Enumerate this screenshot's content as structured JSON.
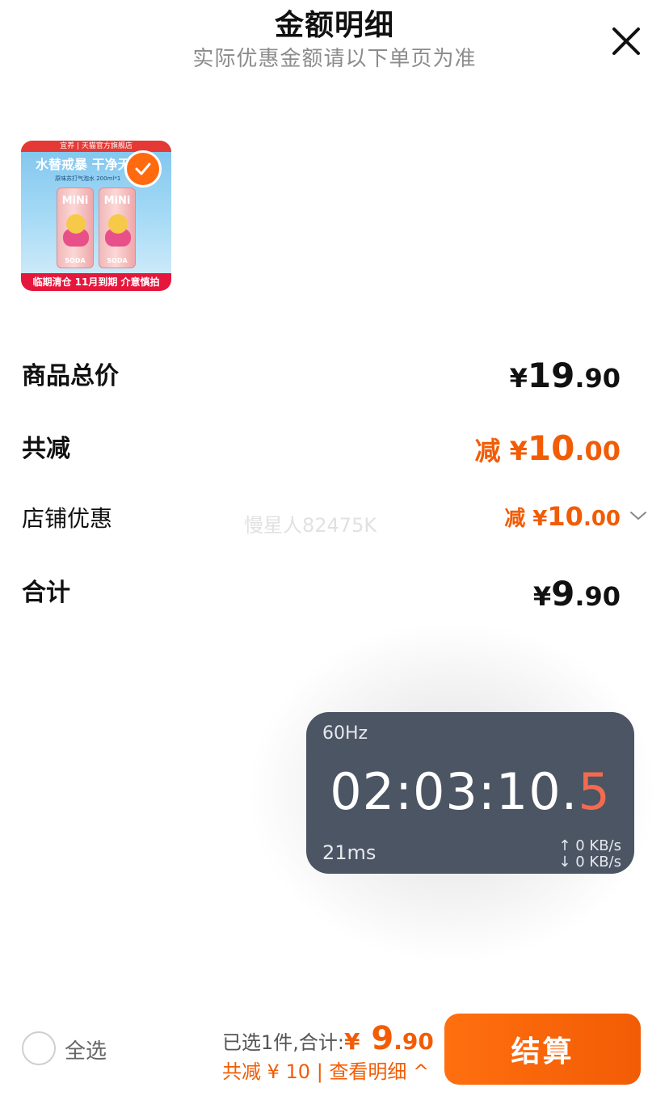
{
  "header": {
    "title": "金额明细",
    "subtitle": "实际优惠金额请以下单页为准"
  },
  "product": {
    "top_banner": "宜养 | 天猫官方旗舰店",
    "slogan": "水替戒暴 干净无",
    "desc": "原味苏打气泡水 200ml*1",
    "can_brand": "MiNi",
    "can_label": "SODA",
    "bottom_banner": "临期清仓 11月到期 介意慎拍",
    "checked": true
  },
  "rows": {
    "total_price": {
      "label": "商品总价",
      "currency": "¥",
      "integer": "19",
      "decimal": ".90"
    },
    "total_discount": {
      "label": "共减",
      "prefix": "减 ¥",
      "integer": "10",
      "decimal": ".00"
    },
    "store_discount": {
      "label": "店铺优惠",
      "prefix": "减 ¥",
      "integer": "10",
      "decimal": ".00"
    },
    "sum": {
      "label": "合计",
      "currency": "¥",
      "integer": "9",
      "decimal": ".90"
    }
  },
  "watermark": "慢星人82475K",
  "timer": {
    "refresh_rate": "60Hz",
    "time_main": "02:03:10.",
    "time_last": "5",
    "latency": "21ms",
    "upload": "↑ 0 KB/s",
    "download": "↓ 0 KB/s"
  },
  "bottom_bar": {
    "select_all": "全选",
    "selected_text": "已选1件,合计:",
    "currency": "¥",
    "integer": " 9",
    "decimal": ".90",
    "discount_text": "共减 ¥ 10 | 查看明细 ^",
    "checkout": "结算"
  },
  "colors": {
    "accent": "#f25c05",
    "timer_bg": "#4b5563",
    "timer_red": "#f26b4f"
  }
}
